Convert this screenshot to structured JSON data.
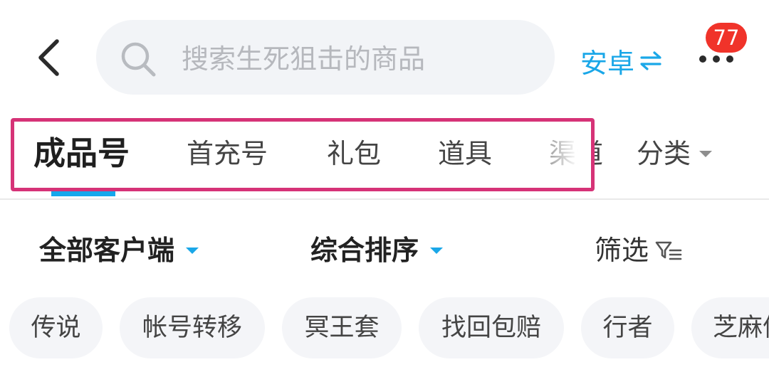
{
  "header": {
    "search_placeholder": "搜索生死狙击的商品",
    "platform_label": "安卓",
    "notification_count": "77"
  },
  "tabs": {
    "items": [
      {
        "label": "成品号",
        "active": true
      },
      {
        "label": "首充号",
        "active": false
      },
      {
        "label": "礼包",
        "active": false
      },
      {
        "label": "道具",
        "active": false
      },
      {
        "label": "渠道",
        "active": false
      }
    ],
    "category_label": "分类"
  },
  "filters": {
    "client": "全部客户端",
    "sort": "综合排序",
    "filter": "筛选"
  },
  "chips": [
    "传说",
    "帐号转移",
    "冥王套",
    "找回包赔",
    "行者",
    "芝麻信用"
  ],
  "colors": {
    "accent": "#1aa7e8",
    "badge": "#f0332a",
    "highlight": "#d63377",
    "chip_bg": "#f4f5f8",
    "search_bg": "#f2f4f7"
  }
}
